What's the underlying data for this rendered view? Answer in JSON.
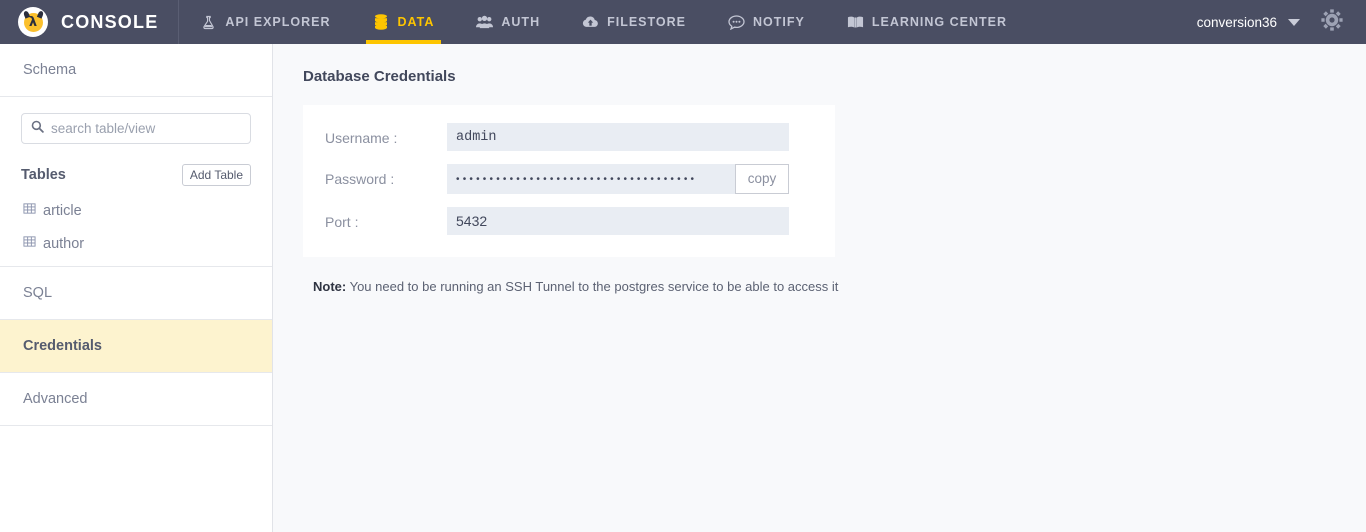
{
  "topnav": {
    "brand": {
      "name": "CONSOLE",
      "logo_icon": "lambda-devil-logo-icon",
      "glyph": "λ"
    },
    "items": [
      {
        "label": "API EXPLORER",
        "icon": "flask-icon",
        "active": false
      },
      {
        "label": "DATA",
        "icon": "database-icon",
        "active": true
      },
      {
        "label": "AUTH",
        "icon": "users-group-icon",
        "active": false
      },
      {
        "label": "FILESTORE",
        "icon": "cloud-upload-icon",
        "active": false
      },
      {
        "label": "NOTIFY",
        "icon": "chat-bubble-icon",
        "active": false
      },
      {
        "label": "LEARNING CENTER",
        "icon": "open-book-icon",
        "active": false
      }
    ],
    "user": {
      "name": "conversion36",
      "caret_icon": "chevron-down-icon"
    },
    "settings_icon": "gear-icon",
    "accent_color": "#fdc500",
    "bar_color": "#4a4e63"
  },
  "sidebar": {
    "schema_label": "Schema",
    "search": {
      "placeholder": "search table/view",
      "value": "",
      "icon": "search-icon"
    },
    "tables_label": "Tables",
    "add_table_label": "Add Table",
    "tables": [
      {
        "name": "article",
        "icon": "table-grid-icon"
      },
      {
        "name": "author",
        "icon": "table-grid-icon"
      }
    ],
    "sql_label": "SQL",
    "credentials_label": "Credentials",
    "advanced_label": "Advanced",
    "active_item": "Credentials",
    "active_color": "#fdf3cf"
  },
  "main": {
    "title": "Database Credentials",
    "fields": {
      "username": {
        "label": "Username :",
        "value": "admin"
      },
      "password": {
        "label": "Password :",
        "value": "••••••••••••••••••••••••••••••••••••",
        "copy_label": "copy"
      },
      "port": {
        "label": "Port :",
        "value": "5432"
      }
    },
    "note": {
      "prefix": "Note:",
      "text": " You need to be running an SSH Tunnel to the postgres service to be able to access it"
    }
  }
}
